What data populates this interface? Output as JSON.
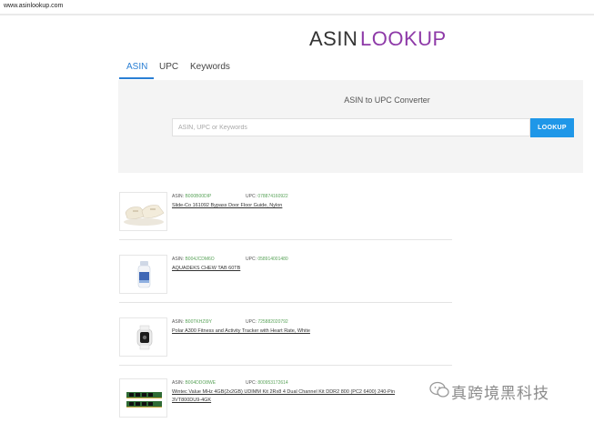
{
  "browser": {
    "url": "www.asinlookup.com"
  },
  "brand": {
    "part1": "ASIN",
    "part2": "LOOKUP",
    "part2_color": "#8e3aa8"
  },
  "tabs": [
    {
      "label": "ASIN",
      "active": true
    },
    {
      "label": "UPC",
      "active": false
    },
    {
      "label": "Keywords",
      "active": false
    }
  ],
  "converter": {
    "title": "ASIN to UPC Converter",
    "placeholder": "ASIN, UPC or Keywords",
    "button_label": "LOOKUP"
  },
  "results": [
    {
      "asin_label": "ASIN:",
      "asin": "B000B00DIP",
      "upc_label": "UPC:",
      "upc": "078874160922",
      "title": "Slide-Co 161092 Bypass Door Floor Guide, Nylon",
      "title2": "",
      "image": "door-floor-guide-image"
    },
    {
      "asin_label": "ASIN:",
      "asin": "B004JCDM6O",
      "upc_label": "UPC:",
      "upc": "058914001480",
      "title": "AQUADEKS CHEW TAB 60TB",
      "title2": "",
      "image": "supplement-bottle-image"
    },
    {
      "asin_label": "ASIN:",
      "asin": "B00TKHZI9Y",
      "upc_label": "UPC:",
      "upc": "725882020792",
      "title": "Polar A300 Fitness and Activity Tracker with Heart Rate, White",
      "title2": "",
      "image": "fitness-tracker-image"
    },
    {
      "asin_label": "ASIN:",
      "asin": "B004DDO8WE",
      "upc_label": "UPC:",
      "upc": "800953172614",
      "title": "Wintec Value MHz 4GB(2x2GB) UDIMM Kit 2Rx8 4 Dual Channel Kit DDR2 800 (PC2 6400) 240-Pin",
      "title2": "3VT800DU9-4GK",
      "image": "memory-module-image"
    }
  ],
  "watermark": {
    "text": "真跨境黑科技"
  }
}
